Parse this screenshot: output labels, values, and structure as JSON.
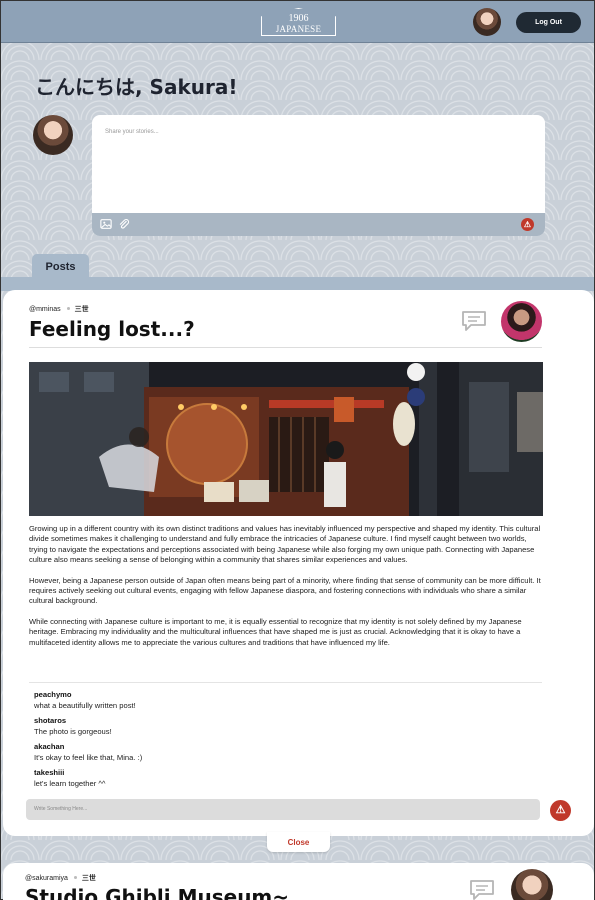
{
  "header": {
    "logo_year": "1906",
    "logo_name": "JAPANESE HALL",
    "logout_label": "Log Out"
  },
  "compose": {
    "greeting": "こんにちは, Sakura!",
    "placeholder": "Share your stories..."
  },
  "tabs": {
    "posts_label": "Posts"
  },
  "post": {
    "username": "@mminas",
    "generation": "三世",
    "title": "Feeling lost...?",
    "paragraphs": [
      "Growing up in a different country with its own distinct traditions and values has inevitably influenced my perspective and shaped my identity. This cultural divide sometimes makes it challenging to understand and fully embrace the intricacies of Japanese culture. I find myself caught between two worlds, trying to navigate the expectations and perceptions associated with being Japanese while also forging my own unique path. Connecting with Japanese culture also means seeking a sense of belonging within a community that shares similar experiences and values.",
      "However, being a Japanese person outside of Japan often means being part of a minority, where finding that sense of community can be more difficult. It requires actively seeking out cultural events, engaging with fellow Japanese diaspora, and fostering connections with individuals who share a similar cultural background.",
      "While connecting with Japanese culture is important to me, it is equally essential to recognize that my identity is not solely defined by my Japanese heritage. Embracing my individuality and the multicultural influences that have shaped me is just as crucial. Acknowledging that it is okay to have a multifaceted identity allows me to appreciate the various cultures and traditions that have influenced my life."
    ],
    "comments": [
      {
        "user": "peachymo",
        "text": "what a beautifully written post!"
      },
      {
        "user": "shotaros",
        "text": "The photo is gorgeous!"
      },
      {
        "user": "akachan",
        "text": "It's okay to feel like that, Mina. :)"
      },
      {
        "user": "takeshiii",
        "text": "let's learn together ^^"
      }
    ],
    "reply_placeholder": "Write Something Here...",
    "close_label": "Close"
  },
  "next_post": {
    "username": "@sakuramiya",
    "generation": "三世",
    "title": "Studio Ghibli Museum~"
  },
  "colors": {
    "header": "#8ea2b7",
    "accent_red": "#c0392b",
    "button_dark": "#1f2933",
    "tab": "#a8b9ca"
  },
  "icons": [
    "user-avatar",
    "image-icon",
    "paperclip-icon",
    "warning-icon",
    "comment-icon"
  ]
}
